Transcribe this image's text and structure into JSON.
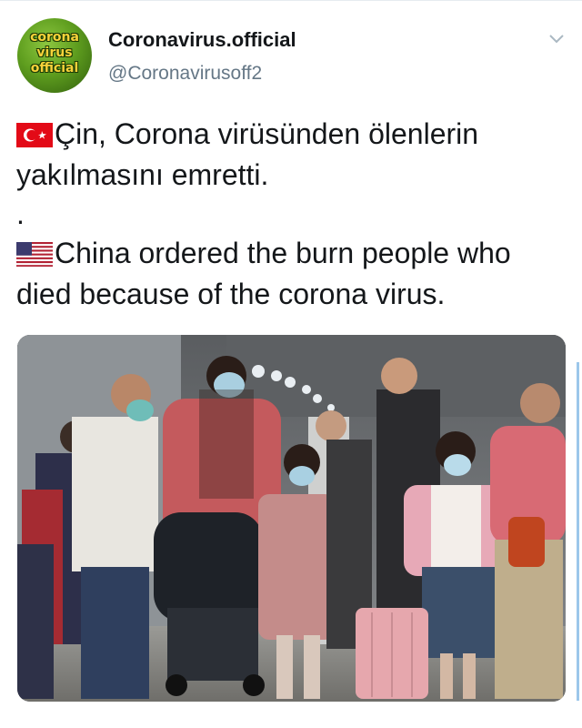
{
  "account": {
    "display_name": "Coronavirus.official",
    "handle": "@Coronavirusoff2",
    "avatar_text": [
      "corona",
      "virus",
      "official"
    ],
    "avatar_icon": "corona-virus-logo-icon"
  },
  "tweet": {
    "line_tr": "Çin, Corona virüsünden ölenlerin yakılmasını emretti.",
    "separator": ".",
    "line_en": "China ordered the burn people who died because of the corona virus.",
    "flag_tr_icon": "turkey-flag-icon",
    "flag_en_icon": "usa-flag-icon"
  },
  "menu_icon": "chevron-down-icon",
  "colors": {
    "text": "#14171a",
    "handle": "#657786",
    "avatar_green": "#5f9e1f",
    "avatar_text": "#f7d23a",
    "accent_strip": "#9cc7ea"
  }
}
